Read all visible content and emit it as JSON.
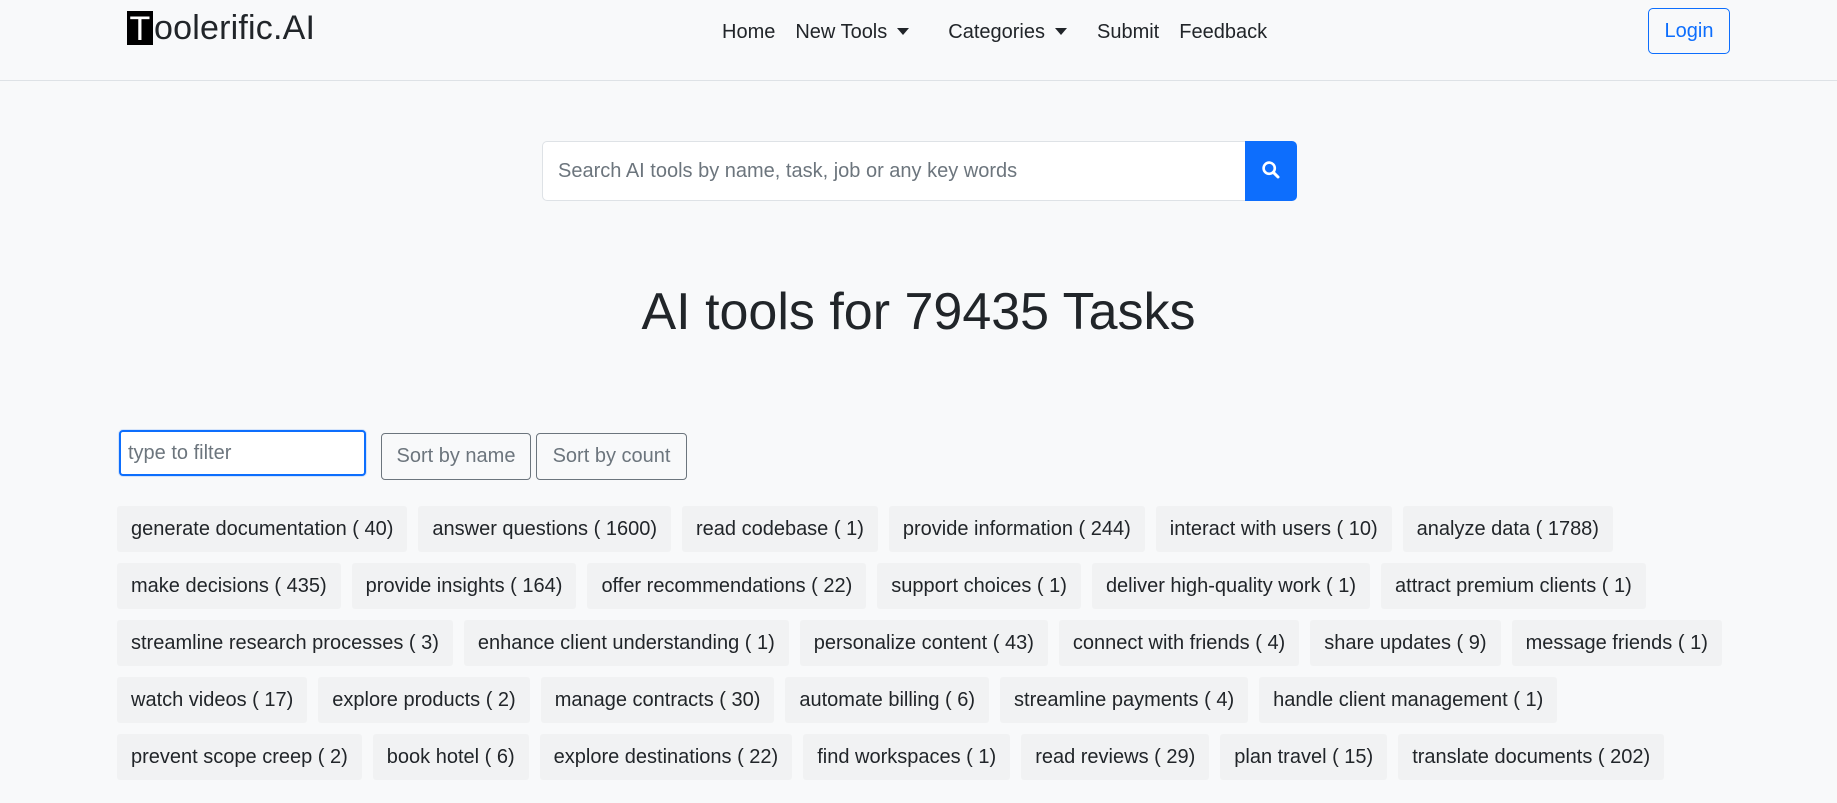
{
  "brand": {
    "first_letter": "T",
    "rest": "oolerific.AI"
  },
  "nav": {
    "home": "Home",
    "new_tools": "New Tools",
    "categories": "Categories",
    "submit": "Submit",
    "feedback": "Feedback",
    "login": "Login"
  },
  "search": {
    "placeholder": "Search AI tools by name, task, job or any key words",
    "icon": "search-icon"
  },
  "hero": {
    "title": "AI tools for 79435 Tasks"
  },
  "filter": {
    "placeholder": "type to filter",
    "sort_by_name": "Sort by name",
    "sort_by_count": "Sort by count"
  },
  "tags": [
    "generate documentation ( 40)",
    "answer questions ( 1600)",
    "read codebase ( 1)",
    "provide information ( 244)",
    "interact with users ( 10)",
    "analyze data ( 1788)",
    "make decisions ( 435)",
    "provide insights ( 164)",
    "offer recommendations ( 22)",
    "support choices ( 1)",
    "deliver high-quality work ( 1)",
    "attract premium clients ( 1)",
    "streamline research processes ( 3)",
    "enhance client understanding ( 1)",
    "personalize content ( 43)",
    "connect with friends ( 4)",
    "share updates ( 9)",
    "message friends ( 1)",
    "watch videos ( 17)",
    "explore products ( 2)",
    "manage contracts ( 30)",
    "automate billing ( 6)",
    "streamline payments ( 4)",
    "handle client management ( 1)",
    "prevent scope creep ( 2)",
    "book hotel ( 6)",
    "explore destinations ( 22)",
    "find workspaces ( 1)",
    "read reviews ( 29)",
    "plan travel ( 15)",
    "translate documents ( 202)"
  ],
  "colors": {
    "primary": "#0d6efd",
    "background": "#f8f9fa",
    "tag_bg": "#f1f2f3"
  }
}
